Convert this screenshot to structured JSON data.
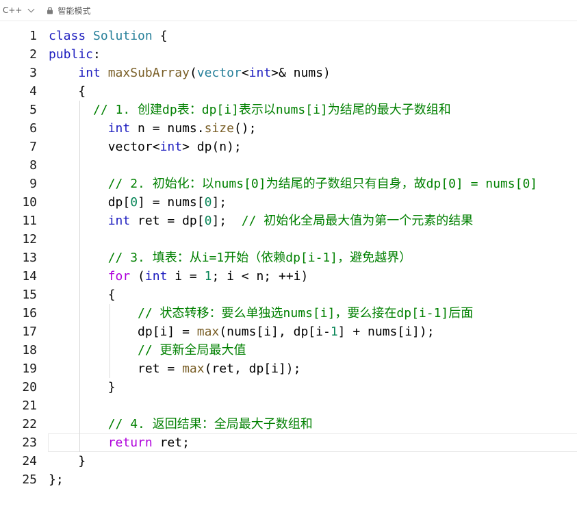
{
  "toolbar": {
    "language": "C++",
    "mode_label": "智能模式",
    "icons": [
      "chevron-down-icon",
      "lock-icon"
    ]
  },
  "colors": {
    "keyword": "#1d1dbf",
    "class": "#267f99",
    "function": "#795e26",
    "number": "#098658",
    "comment": "#008000",
    "control": "#af00db"
  },
  "editor": {
    "current_line": 23,
    "lines": [
      {
        "n": "1",
        "tokens": [
          [
            "kw",
            "class"
          ],
          [
            "p",
            " "
          ],
          [
            "cls",
            "Solution"
          ],
          [
            "p",
            " {"
          ]
        ]
      },
      {
        "n": "2",
        "tokens": [
          [
            "kw",
            "public"
          ],
          [
            "p",
            ":"
          ]
        ]
      },
      {
        "n": "3",
        "tokens": [
          [
            "p",
            "    "
          ],
          [
            "ty",
            "int"
          ],
          [
            "p",
            " "
          ],
          [
            "fn",
            "maxSubArray"
          ],
          [
            "p",
            "("
          ],
          [
            "cls",
            "vector"
          ],
          [
            "p",
            "<"
          ],
          [
            "ty",
            "int"
          ],
          [
            "p",
            ">& nums)"
          ]
        ]
      },
      {
        "n": "4",
        "tokens": [
          [
            "p",
            "    {"
          ]
        ]
      },
      {
        "n": "5",
        "tokens": [
          [
            "p",
            "      "
          ],
          [
            "cm",
            "// 1. 创建dp表：dp[i]表示以nums[i]为结尾的最大子数组和"
          ]
        ]
      },
      {
        "n": "6",
        "tokens": [
          [
            "p",
            "        "
          ],
          [
            "ty",
            "int"
          ],
          [
            "p",
            " n = nums."
          ],
          [
            "fn",
            "size"
          ],
          [
            "p",
            "();"
          ]
        ]
      },
      {
        "n": "7",
        "tokens": [
          [
            "p",
            "        vector<"
          ],
          [
            "ty",
            "int"
          ],
          [
            "p",
            "> dp(n);"
          ]
        ]
      },
      {
        "n": "8",
        "tokens": []
      },
      {
        "n": "9",
        "tokens": [
          [
            "p",
            "        "
          ],
          [
            "cm",
            "// 2. 初始化：以nums[0]为结尾的子数组只有自身，故dp[0] = nums[0]"
          ]
        ]
      },
      {
        "n": "10",
        "tokens": [
          [
            "p",
            "        dp["
          ],
          [
            "num",
            "0"
          ],
          [
            "p",
            "] = nums["
          ],
          [
            "num",
            "0"
          ],
          [
            "p",
            "];"
          ]
        ]
      },
      {
        "n": "11",
        "tokens": [
          [
            "p",
            "        "
          ],
          [
            "ty",
            "int"
          ],
          [
            "p",
            " ret = dp["
          ],
          [
            "num",
            "0"
          ],
          [
            "p",
            "];  "
          ],
          [
            "cm",
            "// 初始化全局最大值为第一个元素的结果"
          ]
        ]
      },
      {
        "n": "12",
        "tokens": []
      },
      {
        "n": "13",
        "tokens": [
          [
            "p",
            "        "
          ],
          [
            "cm",
            "// 3. 填表：从i=1开始（依赖dp[i-1]，避免越界）"
          ]
        ]
      },
      {
        "n": "14",
        "tokens": [
          [
            "p",
            "        "
          ],
          [
            "ctl",
            "for"
          ],
          [
            "p",
            " ("
          ],
          [
            "ty",
            "int"
          ],
          [
            "p",
            " i = "
          ],
          [
            "num",
            "1"
          ],
          [
            "p",
            "; i < n; ++i)"
          ]
        ]
      },
      {
        "n": "15",
        "tokens": [
          [
            "p",
            "        {"
          ]
        ]
      },
      {
        "n": "16",
        "tokens": [
          [
            "p",
            "            "
          ],
          [
            "cm",
            "// 状态转移：要么单独选nums[i]，要么接在dp[i-1]后面"
          ]
        ]
      },
      {
        "n": "17",
        "tokens": [
          [
            "p",
            "            dp[i] = "
          ],
          [
            "bi",
            "max"
          ],
          [
            "p",
            "(nums[i], dp[i-"
          ],
          [
            "num",
            "1"
          ],
          [
            "p",
            "] + nums[i]);"
          ]
        ]
      },
      {
        "n": "18",
        "tokens": [
          [
            "p",
            "            "
          ],
          [
            "cm",
            "// 更新全局最大值"
          ]
        ]
      },
      {
        "n": "19",
        "tokens": [
          [
            "p",
            "            ret = "
          ],
          [
            "bi",
            "max"
          ],
          [
            "p",
            "(ret, dp[i]);"
          ]
        ]
      },
      {
        "n": "20",
        "tokens": [
          [
            "p",
            "        }"
          ]
        ]
      },
      {
        "n": "21",
        "tokens": []
      },
      {
        "n": "22",
        "tokens": [
          [
            "p",
            "        "
          ],
          [
            "cm",
            "// 4. 返回结果：全局最大子数组和"
          ]
        ]
      },
      {
        "n": "23",
        "tokens": [
          [
            "p",
            "        "
          ],
          [
            "ctl",
            "return"
          ],
          [
            "p",
            " ret;"
          ]
        ]
      },
      {
        "n": "24",
        "tokens": [
          [
            "p",
            "    }"
          ]
        ]
      },
      {
        "n": "25",
        "tokens": [
          [
            "p",
            "};"
          ]
        ]
      }
    ]
  }
}
